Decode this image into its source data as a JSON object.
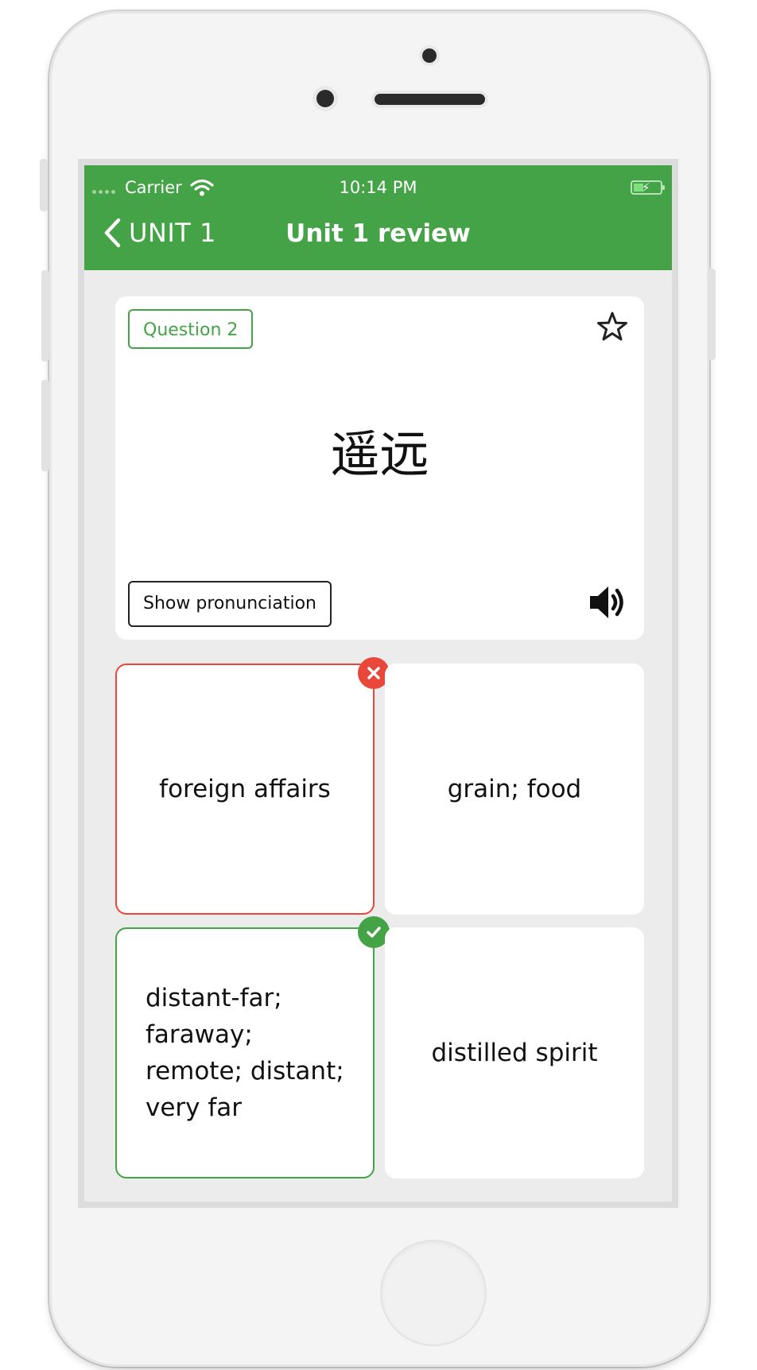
{
  "status_bar": {
    "carrier": "Carrier",
    "time": "10:14 PM"
  },
  "nav": {
    "back_label": "UNIT 1",
    "title": "Unit 1 review"
  },
  "question": {
    "badge": "Question 2",
    "word": "遥远",
    "pronunciation_button": "Show pronunciation"
  },
  "answers": [
    {
      "text": "foreign affairs",
      "state": "wrong"
    },
    {
      "text": "grain; food",
      "state": "neutral"
    },
    {
      "text": "distant-far; faraway; remote; distant; very far",
      "state": "correct"
    },
    {
      "text": "distilled spirit",
      "state": "neutral"
    }
  ],
  "colors": {
    "accent": "#45a347",
    "wrong": "#e8473a",
    "background": "#ececec"
  },
  "icons": [
    "wifi-icon",
    "battery-icon",
    "back-chevron-icon",
    "star-icon",
    "speaker-icon",
    "close-icon",
    "check-icon"
  ]
}
